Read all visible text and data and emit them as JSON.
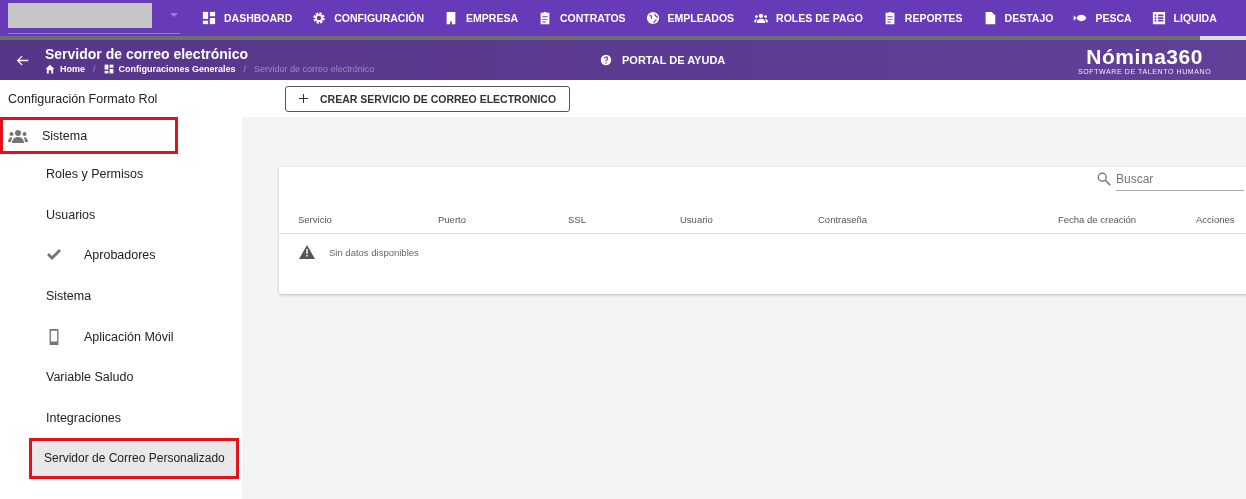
{
  "topnav": {
    "items": [
      {
        "kind": "grid",
        "label": "DASHBOARD"
      },
      {
        "kind": "gear",
        "label": "CONFIGURACIÓN"
      },
      {
        "kind": "building",
        "label": "EMPRESA"
      },
      {
        "kind": "clipboard",
        "label": "CONTRATOS"
      },
      {
        "kind": "globe",
        "label": "EMPLEADOS"
      },
      {
        "kind": "people",
        "label": "ROLES DE PAGO"
      },
      {
        "kind": "clipboard",
        "label": "REPORTES"
      },
      {
        "kind": "document",
        "label": "DESTAJO"
      },
      {
        "kind": "fish",
        "label": "PESCA"
      },
      {
        "kind": "list",
        "label": "LIQUIDA"
      }
    ]
  },
  "header": {
    "title": "Servidor de correo electrónico",
    "breadcrumbs": [
      {
        "kind": "home",
        "label": "Home"
      },
      {
        "kind": "grid",
        "label": "Configuraciones Generales"
      },
      {
        "kind": "plain",
        "label": "Servidor de correo electrónico"
      }
    ],
    "separator": "/",
    "help": "PORTAL DE AYUDA",
    "logo": "Nómina360",
    "logo_tagline": "SOFTWARE DE TALENTO HUMANO"
  },
  "sidebar": {
    "items": [
      {
        "label": "Configuración Formato Rol",
        "kind": "plain",
        "selected": false,
        "highlighted": false
      },
      {
        "label": "Sistema",
        "kind": "people",
        "selected": false,
        "highlighted": true,
        "children": [
          {
            "label": "Roles y Permisos",
            "kind": "plain",
            "selected": false,
            "highlighted": false
          },
          {
            "label": "Usuarios",
            "kind": "plain",
            "selected": false,
            "highlighted": false
          },
          {
            "label": "Aprobadores",
            "kind": "check",
            "selected": false,
            "highlighted": false
          },
          {
            "label": "Sistema",
            "kind": "plain",
            "selected": false,
            "highlighted": false
          },
          {
            "label": "Aplicación Móvil",
            "kind": "phone",
            "selected": false,
            "highlighted": false
          },
          {
            "label": "Variable Saludo",
            "kind": "plain",
            "selected": false,
            "highlighted": false
          },
          {
            "label": "Integraciones",
            "kind": "plain",
            "selected": false,
            "highlighted": false
          },
          {
            "label": "Servidor de Correo Personalizado",
            "kind": "plain",
            "selected": true,
            "highlighted": true
          }
        ]
      }
    ]
  },
  "create_button": "CREAR SERVICIO DE CORREO ELECTRONICO",
  "table": {
    "search": {
      "placeholder": "Buscar"
    },
    "columns": [
      "Servicio",
      "Puerto",
      "SSL",
      "Usuario",
      "Contraseña",
      "Fecha de creación",
      "Acciones"
    ],
    "empty": "Sin datos disponibles"
  }
}
